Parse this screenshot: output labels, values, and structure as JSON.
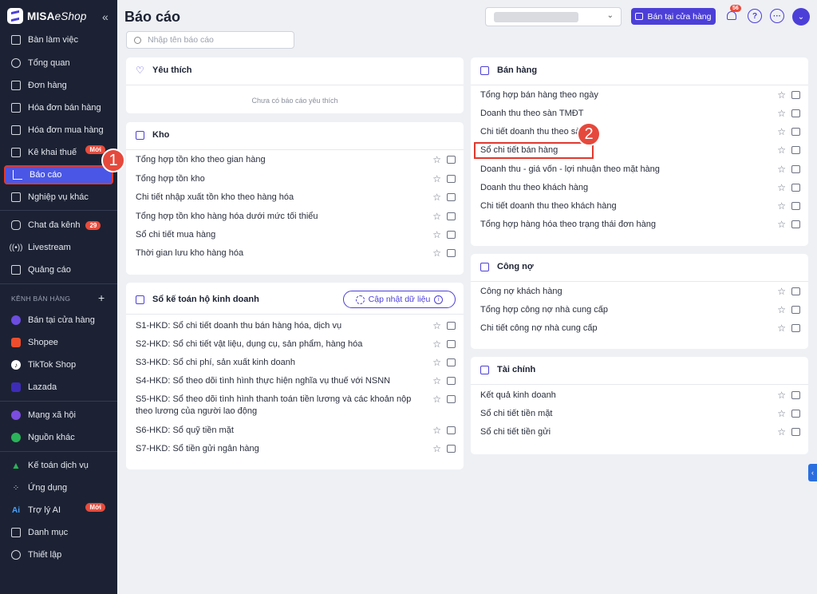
{
  "brand": {
    "name_bold": "MISA",
    "name_rest": "eShop"
  },
  "sidebar": {
    "items": [
      {
        "label": "Bàn làm việc",
        "icon": "desk-icon"
      },
      {
        "label": "Tổng quan",
        "icon": "dashboard-icon"
      },
      {
        "label": "Đơn hàng",
        "icon": "order-icon"
      },
      {
        "label": "Hóa đơn bán hàng",
        "icon": "sales-invoice-icon"
      },
      {
        "label": "Hóa đơn mua hàng",
        "icon": "purchase-invoice-icon"
      },
      {
        "label": "Kê khai thuế",
        "icon": "tax-icon",
        "badge": "Mới"
      },
      {
        "label": "Báo cáo",
        "icon": "report-icon",
        "active": true
      },
      {
        "label": "Nghiệp vụ khác",
        "icon": "operations-icon"
      },
      {
        "label": "Chat đa kênh",
        "icon": "chat-icon",
        "count": "29"
      },
      {
        "label": "Livestream",
        "icon": "livestream-icon"
      },
      {
        "label": "Quảng cáo",
        "icon": "ads-icon"
      }
    ],
    "channels_header": "KÊNH BÁN HÀNG",
    "channels": [
      {
        "label": "Bán tại cửa hàng",
        "icon": "store-icon",
        "color": "#6c4de0"
      },
      {
        "label": "Shopee",
        "icon": "shopee-icon",
        "color": "#ee4d2d"
      },
      {
        "label": "TikTok Shop",
        "icon": "tiktok-icon",
        "color": "#111111"
      },
      {
        "label": "Lazada",
        "icon": "lazada-icon",
        "color": "#3d2cb8"
      }
    ],
    "more": [
      {
        "label": "Mạng xã hội",
        "icon": "social-icon",
        "color": "#7b4de0"
      },
      {
        "label": "Nguồn khác",
        "icon": "other-source-icon",
        "color": "#2bb35a"
      }
    ],
    "bottom": [
      {
        "label": "Kế toán dịch vụ",
        "icon": "accounting-icon",
        "color": "#2bb35a"
      },
      {
        "label": "Ứng dụng",
        "icon": "apps-icon"
      },
      {
        "label": "Trợ lý AI",
        "icon": "ai-icon",
        "badge": "Mới"
      },
      {
        "label": "Danh mục",
        "icon": "catalog-icon"
      },
      {
        "label": "Thiết lập",
        "icon": "settings-icon"
      }
    ]
  },
  "markers": {
    "one": "1",
    "two": "2"
  },
  "header": {
    "title": "Báo cáo",
    "sell_button": "Bán tại cửa hàng",
    "notif_count": "56",
    "search_placeholder": "Nhập tên báo cáo"
  },
  "favorites": {
    "title": "Yêu thích",
    "empty": "Chưa có báo cáo yêu thích"
  },
  "kho": {
    "title": "Kho",
    "rows": [
      "Tổng hợp tồn kho theo gian hàng",
      "Tổng hợp tồn kho",
      "Chi tiết nhập xuất tồn kho theo hàng hóa",
      "Tổng hợp tồn kho hàng hóa dưới mức tối thiểu",
      "Sổ chi tiết mua hàng",
      "Thời gian lưu kho hàng hóa"
    ]
  },
  "ketoan": {
    "title": "Sổ kế toán hộ kinh doanh",
    "sync_button": "Cập nhật dữ liệu",
    "rows": [
      "S1-HKD: Sổ chi tiết doanh thu bán hàng hóa, dịch vụ",
      "S2-HKD: Sổ chi tiết vật liệu, dụng cụ, sản phẩm, hàng hóa",
      "S3-HKD: Sổ chi phí, sản xuất kinh doanh",
      "S4-HKD: Sổ theo dõi tình hình thực hiện nghĩa vụ thuế với NSNN",
      "S5-HKD: Sổ theo dõi tình hình thanh toán tiền lương và các khoản nộp theo lương của người lao động",
      "S6-HKD: Sổ quỹ tiền mặt",
      "S7-HKD: Sổ tiền gửi ngân hàng"
    ]
  },
  "banhang": {
    "title": "Bán hàng",
    "rows": [
      "Tổng hợp bán hàng theo ngày",
      "Doanh thu theo sàn TMĐT",
      "Chi tiết doanh thu theo sàn",
      "Sổ chi tiết bán hàng",
      "Doanh thu - giá vốn - lợi nhuận theo mặt hàng",
      "Doanh thu theo khách hàng",
      "Chi tiết doanh thu theo khách hàng",
      "Tổng hợp hàng hóa theo trạng thái đơn hàng"
    ]
  },
  "congno": {
    "title": "Công nợ",
    "rows": [
      "Công nợ khách hàng",
      "Tổng hợp công nợ nhà cung cấp",
      "Chi tiết công nợ nhà cung cấp"
    ]
  },
  "taichinh": {
    "title": "Tài chính",
    "rows": [
      "Kết quả kinh doanh",
      "Sổ chi tiết tiền mặt",
      "Sổ chi tiết tiền gửi"
    ]
  }
}
